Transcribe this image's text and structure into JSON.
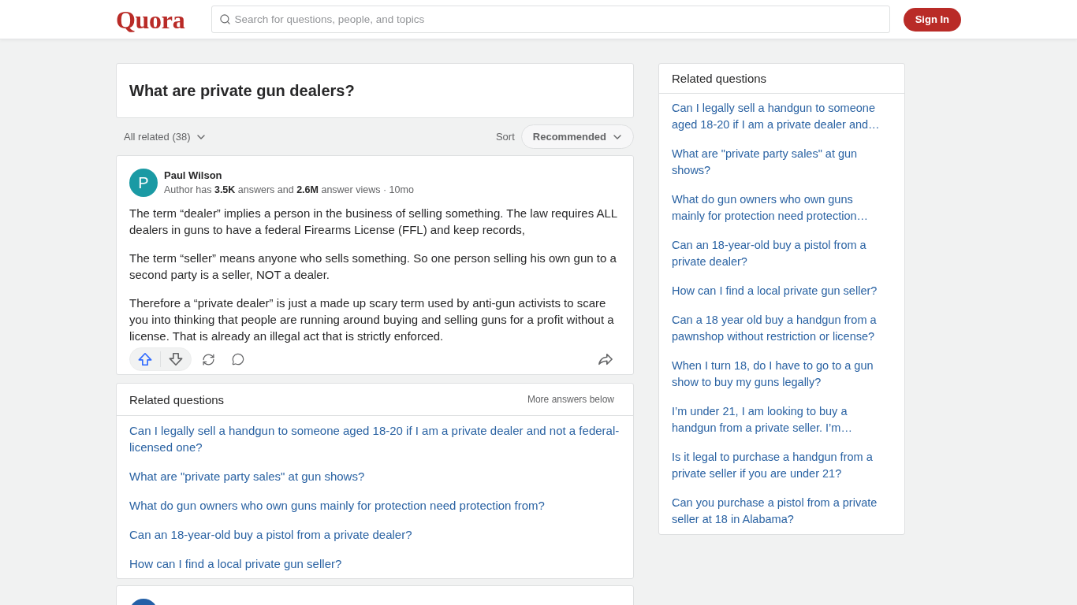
{
  "header": {
    "logo": "Quora",
    "search": {
      "placeholder": "Search for questions, people, and topics"
    },
    "sign_in": "Sign In"
  },
  "question": {
    "title": "What are private gun dealers?"
  },
  "filter_bar": {
    "related": "All related (38)",
    "sort_label": "Sort",
    "sort": "Recommended"
  },
  "feed": [
    {
      "kind": "answer",
      "avatar_letter": "P",
      "color": "#1a9aa4",
      "author": "Paul Wilson",
      "credentials": "Author has **3.5K** answers and **2.6M** answer views · 10mo",
      "paragraphs": [
        "The term “dealer” implies a person in the business of selling something. The law requires ALL dealers in guns to have a federal Firearms License (FFL) and keep records,",
        "The term “seller” means anyone who sells something. So one person selling his own gun to a second party is a seller, NOT a dealer.",
        "Therefore a “private dealer” is just a made up scary term used by anti-gun activists to scare you into thinking that people are running around buying and selling guns for a profit without a license. That is already an illegal act that is strictly enforced."
      ]
    },
    {
      "kind": "related",
      "title": "Related questions",
      "note": "More answers below",
      "items": [
        "Can I legally sell a handgun to someone aged 18-20 if I am a private dealer and not a federal-licensed one?",
        "What are \"private party sales\" at gun shows?",
        "What do gun owners who own guns mainly for protection need protection from?",
        "Can an 18-year-old buy a pistol from a private dealer?",
        "How can I find a local private gun seller?"
      ]
    },
    {
      "kind": "answer",
      "color": "#2460a7"
    }
  ],
  "sidebar": {
    "title": "Related questions",
    "items": [
      "Can I legally sell a handgun to someone aged 18-20 if I am a private dealer and…",
      "What are \"private party sales\" at gun shows?",
      "What do gun owners who own guns mainly for protection need protection…",
      "Can an 18-year-old buy a pistol from a private dealer?",
      "How can I find a local private gun seller?",
      "Can a 18 year old buy a handgun from a pawnshop without restriction or license?",
      "When I turn 18, do I have to go to a gun show to buy my guns legally?",
      "I’m under 21, I am looking to buy a handgun from a private seller. I’m…",
      "Is it legal to purchase a handgun from a private seller if you are under 21?",
      "Can you purchase a pistol from a private seller at 18 in Alabama?"
    ]
  }
}
